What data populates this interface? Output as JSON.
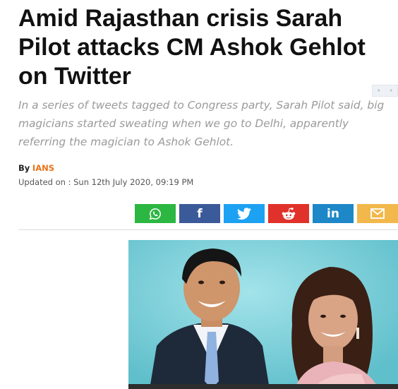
{
  "article": {
    "headline": "Amid Rajasthan crisis Sarah Pilot attacks CM Ashok Gehlot on Twitter",
    "standfirst": "In a series of tweets tagged to Congress party, Sarah Pilot said, big magicians started sweating when we go to Delhi, apparently referring the magician to Ashok Gehlot.",
    "byline_prefix": "By",
    "author": "IANS",
    "updated": "Updated on : Sun 12th July 2020, 09:19 PM"
  },
  "share": [
    {
      "name": "whatsapp",
      "color": "#2cb742",
      "icon": "whatsapp-icon"
    },
    {
      "name": "facebook",
      "color": "#3b5a99",
      "icon": "facebook-icon",
      "glyph": "f"
    },
    {
      "name": "twitter",
      "color": "#1da1f2",
      "icon": "twitter-icon"
    },
    {
      "name": "reddit",
      "color": "#e0322a",
      "icon": "reddit-icon"
    },
    {
      "name": "linkedin",
      "color": "#1d87c7",
      "icon": "linkedin-icon",
      "glyph": "in"
    },
    {
      "name": "email",
      "color": "#f2b84b",
      "icon": "email-icon"
    }
  ]
}
